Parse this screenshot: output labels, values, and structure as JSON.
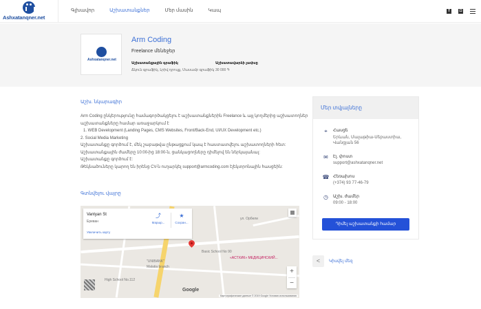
{
  "header": {
    "logo_text": "Ashxatanqner.net",
    "nav": [
      "Գլխավոր",
      "Աշխատանքներ",
      "Մեր մասին",
      "Կապ"
    ],
    "active_index": 1
  },
  "company": {
    "logo_text": "Ashxatanqner.net",
    "name": "Arm Coding",
    "subtitle": "Freelance մենեջեր",
    "field1_label": "Աշխատանքային գրաֆիկ",
    "field1_value": "Ճկուն գրաֆիկ, Լրիվ դրույք, Մասամբ գրաֆիկ",
    "field2_label": "Աշխատավարձի չափսը",
    "field2_value": "30 000 ֏"
  },
  "description": {
    "title": "Աշխ. նկարագիր",
    "lines": [
      "Arm Coding ընկերությունը համագործակցելու է աշխատանքներին Freelance և այլ կողմերից աշխատողներ",
      "աշխատանքները համար առաջարկում է",
      "1. WEB Development (Landing Pages, CMS Websites, Front/Back-End, UI/UX Development etc.)",
      "2. Social Media Marketing",
      "Աշխատանքը գործում է, մեկ շաբաթվա ընթացքում կապ է հաստատվելու աշխատողների հետ:",
      "Աշխատանքային ժամերը 10:00-ից 18:00-ն, ցանկացողները դիմելով են ներկայանալ:",
      "Աշխատանքը գործում է:",
      "Թեկնածուները կարող են իրենց CV-ն ուղարկել support@armcoding.com էլեկտրոնային հասցեին:"
    ]
  },
  "map_section": {
    "title": "Գտնվելու վայրը",
    "card_title": "Vantyan St",
    "card_city": "Ереван",
    "card_link": "Увеличить карту",
    "btn_route": "Маршр...",
    "btn_save": "Сохран...",
    "zoom_in": "+",
    "zoom_out": "−",
    "labels": {
      "street1": "Vantyan St",
      "school90": "Basic School No 90",
      "school112": "High School No.112",
      "unibank": "\"UNIBANK\"",
      "malatia": "Malatia branch",
      "astik": "«АСТХИК» МЕДИЦИНСКИЙ...",
      "street2": "ул. Орбели"
    },
    "google": "Google",
    "attribution": "Картографические данные © 2019 Google   Условия использования"
  },
  "contact": {
    "title": "Մեր տվյալները",
    "address_label": "Հասցե",
    "address_lines": [
      "Երևան, Մալաթիա-Սեբաստիա,",
      "Վանցյան 56"
    ],
    "email_label": "Էլ. փոստ",
    "email": "support@ashxatanqner.net",
    "phone_label": "Հեռախոս",
    "phone": "(+374) 93 77-46-79",
    "hours_label": "Աշխ. ժամեր",
    "hours": "09:00 - 18:00",
    "apply_button": "Դիմել աշխատանքի համար"
  },
  "share": {
    "label": "Կիսվել մեզ"
  }
}
